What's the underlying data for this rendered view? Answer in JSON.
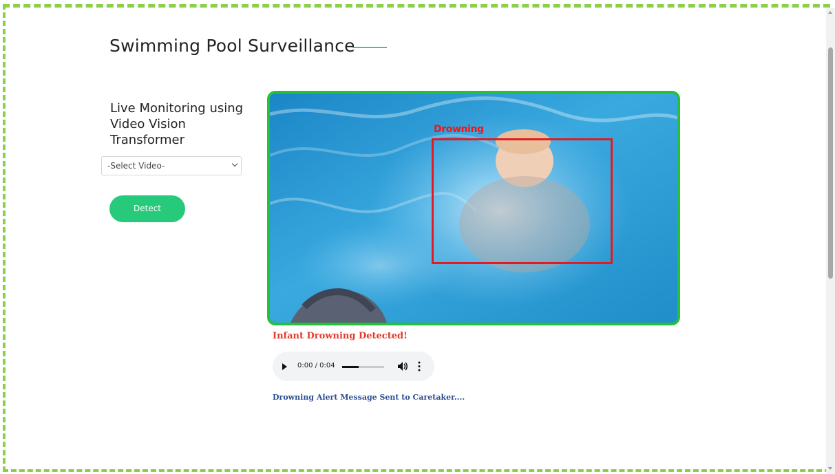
{
  "page": {
    "title": "Swimming Pool Surveillance"
  },
  "sidebar": {
    "heading": "Live Monitoring using Video Vision Transformer",
    "select_value": "-Select Video-",
    "detect_label": "Detect"
  },
  "video": {
    "bbox_label": "Drowning"
  },
  "alert": {
    "message": "Infant Drowning Detected!",
    "status": "Drowning Alert Message Sent to Caretaker...."
  },
  "audio": {
    "time": "0:00 / 0:04",
    "progress": 0.4
  },
  "colors": {
    "accent": "#27c97a",
    "alert": "#e33b2a",
    "status": "#2d4f93",
    "frame": "#24c239",
    "bbox": "#e21b23"
  },
  "icons": [
    "play-icon",
    "volume-icon",
    "more-vertical-icon",
    "chevron-down-icon"
  ]
}
